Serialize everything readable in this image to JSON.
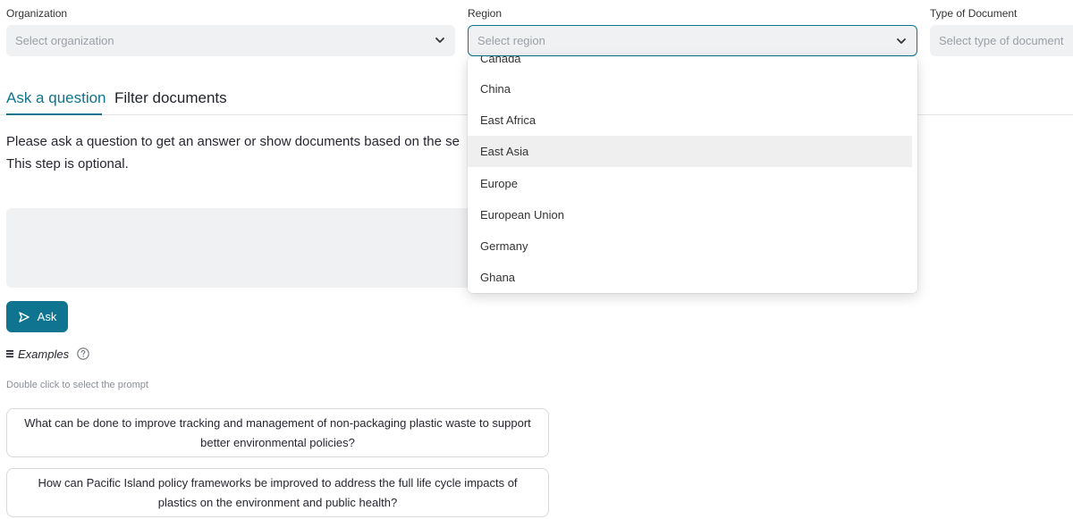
{
  "filters": {
    "organization": {
      "label": "Organization",
      "placeholder": "Select organization"
    },
    "region": {
      "label": "Region",
      "placeholder": "Select region"
    },
    "doc_type": {
      "label": "Type of Document",
      "placeholder": "Select type of document"
    }
  },
  "region_dropdown": {
    "options": [
      "Canada",
      "China",
      "East Africa",
      "East Asia",
      "Europe",
      "European Union",
      "Germany",
      "Ghana"
    ],
    "highlighted": "East Asia"
  },
  "tabs": [
    {
      "label": "Ask a question",
      "active": true
    },
    {
      "label": "Filter documents",
      "active": false
    }
  ],
  "instructions": {
    "line1": "Please ask a question to get an answer or show documents based on the se",
    "line2": "This step is optional."
  },
  "ask_button": {
    "label": "Ask",
    "icon": "send-icon"
  },
  "examples": {
    "title": "Examples",
    "hint": "Double click to select the prompt",
    "items": [
      "What can be done to improve tracking and management of non-packaging plastic waste to support better environmental policies?",
      "How can Pacific Island policy frameworks be improved to address the full life cycle impacts of plastics on the environment and public health?"
    ]
  },
  "colors": {
    "accent": "#0e7490",
    "input_bg": "#f0f1f3"
  }
}
